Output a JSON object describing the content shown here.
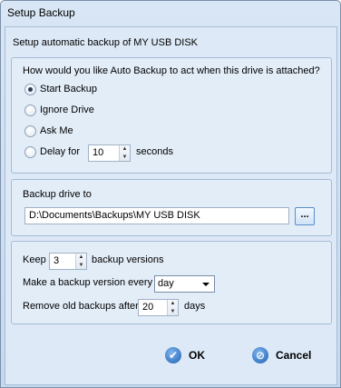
{
  "window": {
    "title": "Setup Backup"
  },
  "header": {
    "subtitle": "Setup automatic backup of MY USB DISK"
  },
  "attach_group": {
    "question": "How would you like Auto Backup to act when this drive is attached?",
    "options": [
      {
        "label": "Start Backup",
        "checked": true
      },
      {
        "label": "Ignore Drive",
        "checked": false
      },
      {
        "label": "Ask Me",
        "checked": false
      },
      {
        "label": "Delay for",
        "checked": false
      }
    ],
    "delay_value": "10",
    "delay_unit": "seconds"
  },
  "drive_group": {
    "label": "Backup drive to",
    "path": "D:\\Documents\\Backups\\MY USB DISK",
    "browse_label": "..."
  },
  "versions_group": {
    "keep_label": "Keep",
    "keep_value": "3",
    "keep_suffix": "backup versions",
    "every_label": "Make a backup version every",
    "every_value": "day",
    "remove_label": "Remove old backups after",
    "remove_value": "20",
    "remove_suffix": "days"
  },
  "buttons": {
    "ok_label": "OK",
    "cancel_label": "Cancel"
  },
  "icons": {
    "ok": "check-circle-icon",
    "cancel": "cancel-circle-icon",
    "spin_up": "chevron-up-icon",
    "spin_down": "chevron-down-icon",
    "dropdown": "dropdown-arrow-icon"
  }
}
